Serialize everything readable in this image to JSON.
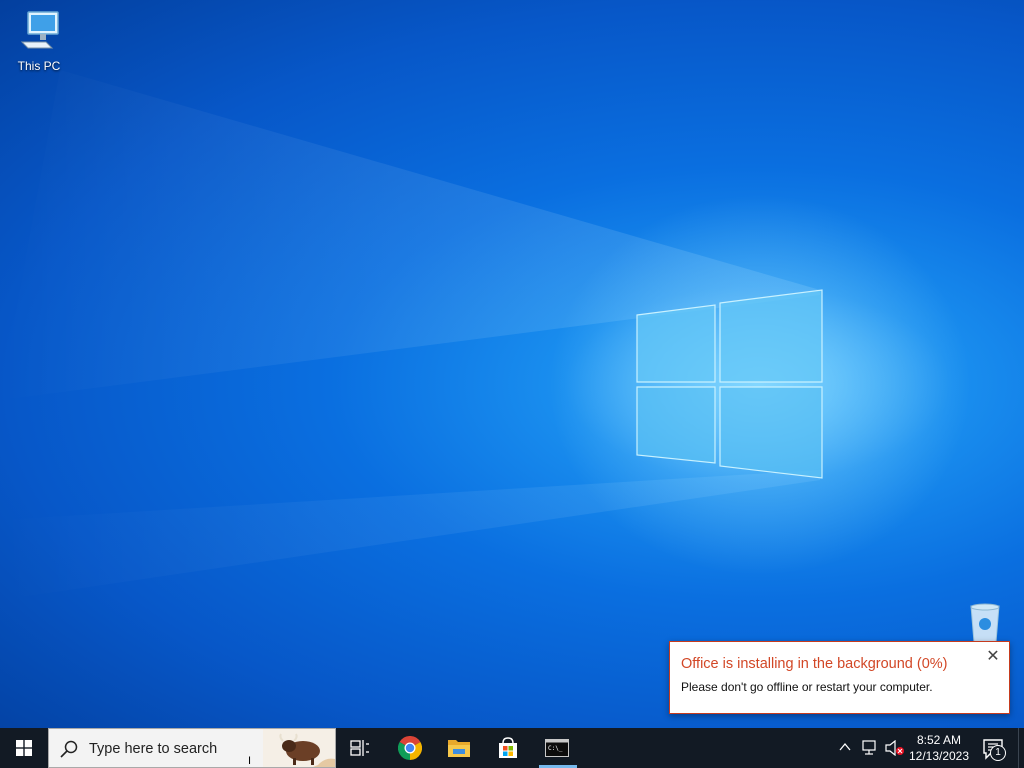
{
  "desktop": {
    "icons": [
      {
        "label": "This PC",
        "icon": "computer-icon"
      },
      {
        "label": "",
        "icon": "recycle-bin-icon"
      }
    ]
  },
  "notification": {
    "title": "Office is installing in the background (0%)",
    "body": "Please don't go offline or restart your computer.",
    "close_icon": "close-icon",
    "accent_color": "#d24726",
    "progress_percent": 0
  },
  "taskbar": {
    "search": {
      "placeholder": "Type here to search"
    },
    "apps": [
      {
        "name": "Task View",
        "icon": "task-view-icon"
      },
      {
        "name": "Google Chrome",
        "icon": "chrome-icon"
      },
      {
        "name": "File Explorer",
        "icon": "folder-icon"
      },
      {
        "name": "Microsoft Store",
        "icon": "store-icon"
      },
      {
        "name": "Command Prompt",
        "icon": "terminal-icon",
        "active": true
      }
    ],
    "tray": {
      "time": "8:52 AM",
      "date": "12/13/2023",
      "action_center_count": "1"
    }
  },
  "colors": {
    "taskbar": "#121a24",
    "wallpaper": "#0a6fe0",
    "active_indicator": "#76b9ed"
  }
}
